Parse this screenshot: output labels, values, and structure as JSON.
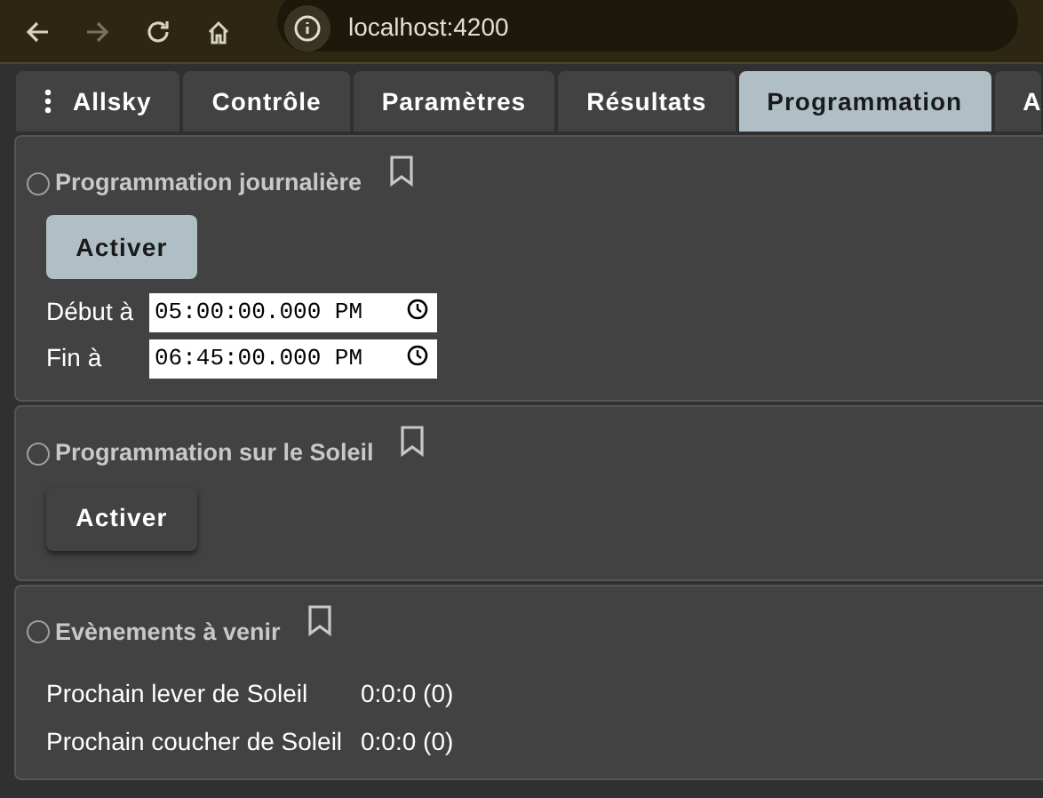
{
  "browser": {
    "address": "localhost:4200"
  },
  "tabs": [
    {
      "label": "Allsky",
      "selected": false,
      "menu": true
    },
    {
      "label": "Contrôle",
      "selected": false
    },
    {
      "label": "Paramètres",
      "selected": false
    },
    {
      "label": "Résultats",
      "selected": false
    },
    {
      "label": "Programmation",
      "selected": true
    },
    {
      "label": "A",
      "selected": false
    }
  ],
  "sections": [
    {
      "kind": "daily",
      "title": "Programmation journalière",
      "checked": false,
      "button": "Activer",
      "active": true,
      "fields": [
        {
          "label": "Début à",
          "value": "05:00:00.000 PM"
        },
        {
          "label": "Fin à",
          "value": "06:45:00.000 PM"
        }
      ]
    },
    {
      "kind": "sun",
      "title": "Programmation sur le Soleil",
      "checked": false,
      "button": "Activer",
      "active": false
    },
    {
      "kind": "events",
      "title": "Evènements à venir",
      "checked": false,
      "rows": [
        {
          "label": "Prochain lever de Soleil",
          "value": "0:0:0 (0)"
        },
        {
          "label": "Prochain coucher de Soleil",
          "value": "0:0:0 (0)"
        }
      ]
    }
  ]
}
